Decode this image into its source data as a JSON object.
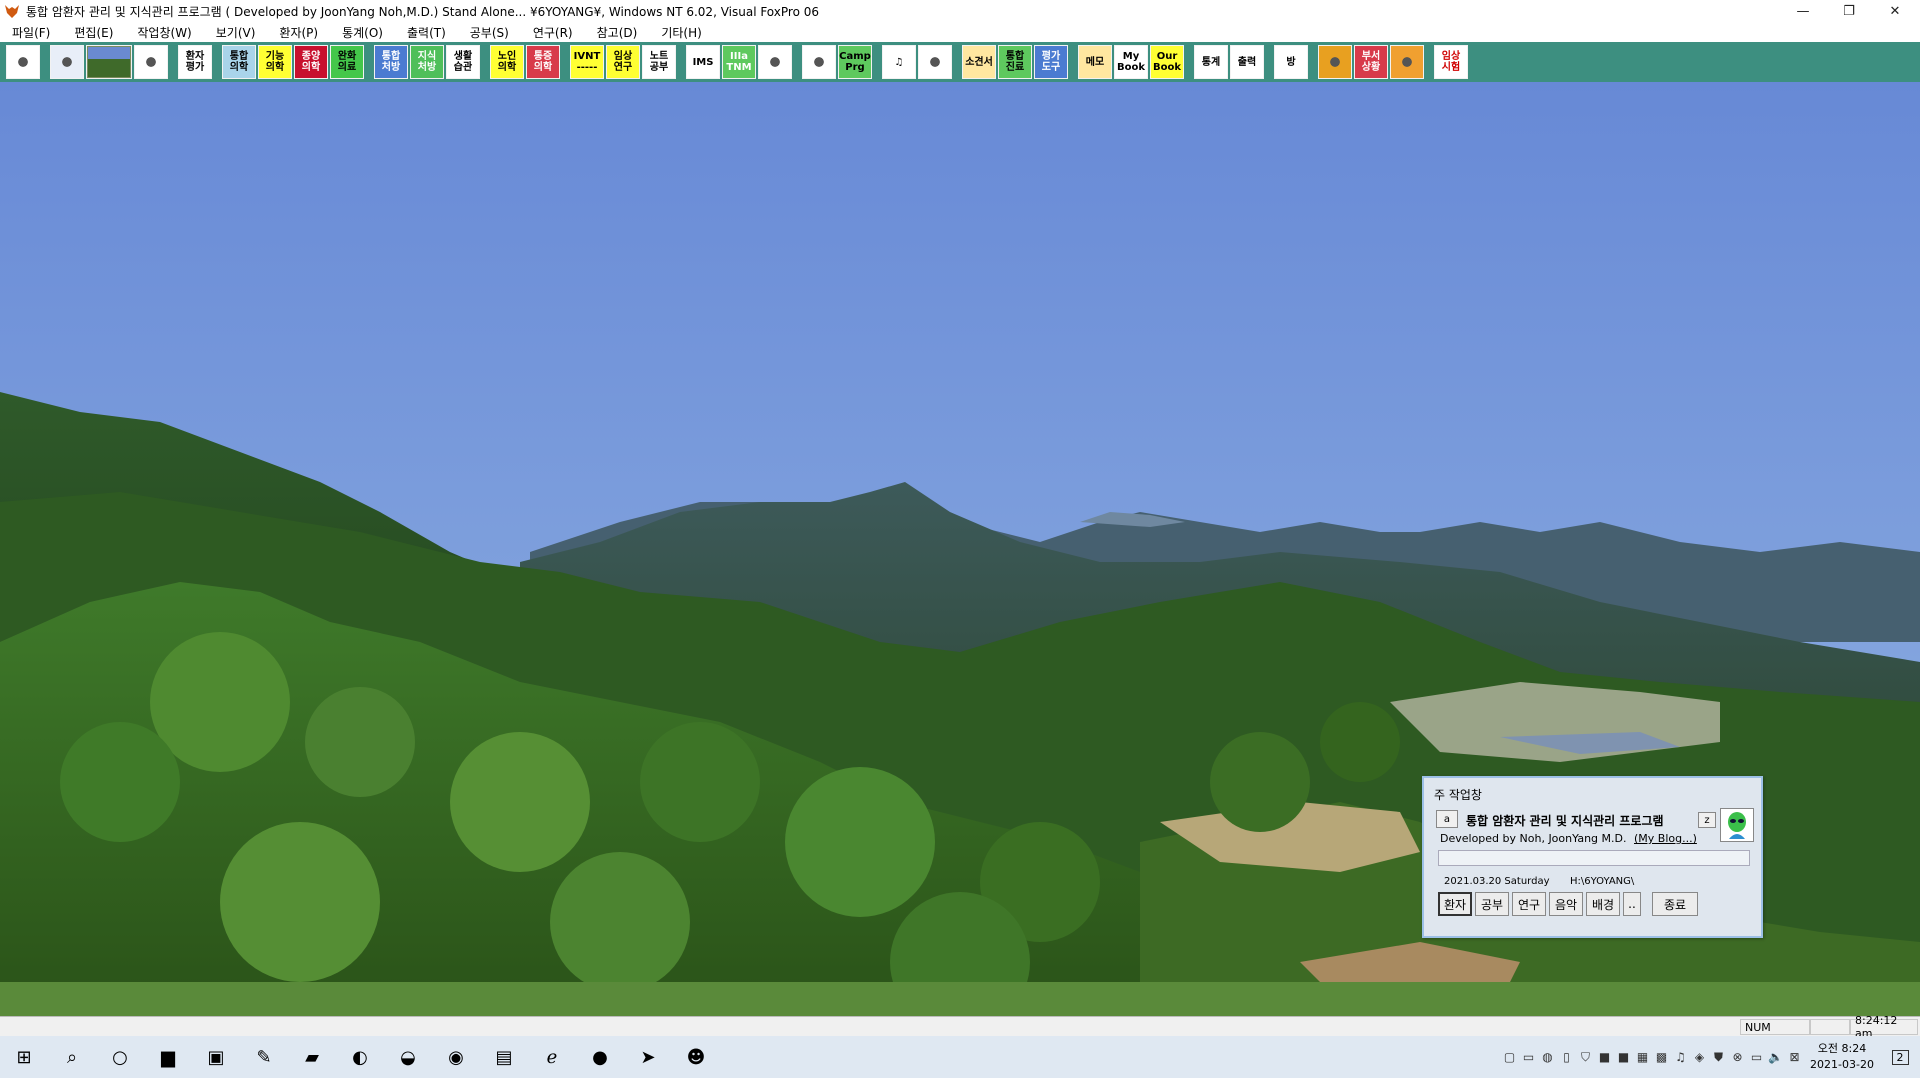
{
  "window": {
    "title": "통합 암환자 관리 및 지식관리 프로그램 ( Developed by JoonYang Noh,M.D.)   Stand Alone... ¥6YOYANG¥, Windows NT 6.02, Visual FoxPro 06",
    "min_glyph": "—",
    "max_glyph": "❐",
    "close_glyph": "✕"
  },
  "menu": [
    "파일(F)",
    "편집(E)",
    "작업창(W)",
    "보기(V)",
    "환자(P)",
    "통계(O)",
    "출력(T)",
    "공부(S)",
    "연구(R)",
    "참고(D)",
    "기타(H)"
  ],
  "toolbar": [
    {
      "label": "",
      "icon": "exit-icon",
      "bg": "#ffffff"
    },
    {
      "label": "",
      "icon": "monitor-icon",
      "bg": "#e8eef8"
    },
    {
      "label": "",
      "icon": "landscape-icon",
      "bg": "#7b8c5e",
      "wide": true
    },
    {
      "label": "",
      "icon": "face-icon",
      "bg": "#ffffff"
    },
    {
      "label": "환자\n평가",
      "icon": "",
      "bg": "#ffffff"
    },
    {
      "label": "통합\n의학",
      "icon": "",
      "bg": "#a9d4ea"
    },
    {
      "label": "기능\n의학",
      "icon": "",
      "bg": "#ffff33"
    },
    {
      "label": "종양\n의학",
      "icon": "",
      "bg": "#c8102e",
      "fg": "#ffffff"
    },
    {
      "label": "완화\n의료",
      "icon": "",
      "bg": "#44c74a"
    },
    {
      "label": "통합\n처방",
      "icon": "",
      "bg": "#4b7bd1",
      "fg": "#ffffff"
    },
    {
      "label": "지식\n처방",
      "icon": "",
      "bg": "#4fbf5a",
      "fg": "#ffffff"
    },
    {
      "label": "생활\n습관",
      "icon": "",
      "bg": "#ffffff"
    },
    {
      "label": "노인\n의학",
      "icon": "",
      "bg": "#ffff33"
    },
    {
      "label": "통증\n의학",
      "icon": "",
      "bg": "#d83a4a",
      "fg": "#ffffff"
    },
    {
      "label": "IVNT\n-----",
      "icon": "",
      "bg": "#ffff33"
    },
    {
      "label": "임상\n연구",
      "icon": "",
      "bg": "#ffff33"
    },
    {
      "label": "노트\n공부",
      "icon": "",
      "bg": "#ffffff"
    },
    {
      "label": "IMS",
      "icon": "",
      "bg": "#ffffff"
    },
    {
      "label": "IIIa\nTNM",
      "icon": "",
      "bg": "#5ec95e",
      "fg": "#ffffff"
    },
    {
      "label": "",
      "icon": "table-icon",
      "bg": "#ffffff"
    },
    {
      "label": "",
      "icon": "person-icon",
      "bg": "#ffffff"
    },
    {
      "label": "Camp\nPrg",
      "icon": "",
      "bg": "#5ec95e"
    },
    {
      "label": "♫",
      "icon": "music-icon",
      "bg": "#ffffff"
    },
    {
      "label": "",
      "icon": "meditation-icon",
      "bg": "#ffffff"
    },
    {
      "label": "소견서",
      "icon": "",
      "bg": "#ffe7a0"
    },
    {
      "label": "통합\n진료",
      "icon": "",
      "bg": "#5ec95e"
    },
    {
      "label": "평가\n도구",
      "icon": "",
      "bg": "#4b7bd1",
      "fg": "#ffffff"
    },
    {
      "label": "메모",
      "icon": "",
      "bg": "#ffe7a0"
    },
    {
      "label": "My\nBook",
      "icon": "",
      "bg": "#ffffff"
    },
    {
      "label": "Our\nBook",
      "icon": "",
      "bg": "#ffff33"
    },
    {
      "label": "통계",
      "icon": "",
      "bg": "#ffffff"
    },
    {
      "label": "출력",
      "icon": "",
      "bg": "#ffffff"
    },
    {
      "label": "방",
      "icon": "",
      "bg": "#ffffff"
    },
    {
      "label": "",
      "icon": "badge-icon",
      "bg": "#e8a020"
    },
    {
      "label": "부서\n상황",
      "icon": "",
      "bg": "#d83a4a",
      "fg": "#ffffff"
    },
    {
      "label": "",
      "icon": "food-icon",
      "bg": "#f0a030"
    },
    {
      "label": "임상\n시험",
      "icon": "",
      "bg": "#ffffff",
      "fg": "#d00000"
    }
  ],
  "main_window": {
    "title": "주 작업창",
    "a_button": "a",
    "app_name": "통합 암환자 관리 및 지식관리 프로그램",
    "z_button": "z",
    "developer": "Developed by Noh, JoonYang  M.D.",
    "blog_link": "(My Blog...)",
    "date": "2021.03.20 Saturday",
    "path": "H:\\6YOYANG\\",
    "buttons": [
      "환자",
      "공부",
      "연구",
      "음악",
      "배경",
      "..",
      "종료"
    ]
  },
  "status_bar": {
    "num": "NUM",
    "time": "8:24:12 am"
  },
  "taskbar": {
    "apps": [
      {
        "glyph": "⊞",
        "name": "windows-start-icon"
      },
      {
        "glyph": "⌕",
        "name": "search-icon"
      },
      {
        "glyph": "○",
        "name": "cortana-icon"
      },
      {
        "glyph": "▆",
        "name": "file-explorer-icon"
      },
      {
        "glyph": "▣",
        "name": "save-disk-icon"
      },
      {
        "glyph": "✎",
        "name": "paint-icon"
      },
      {
        "glyph": "▰",
        "name": "notes-icon"
      },
      {
        "glyph": "◐",
        "name": "edge-icon"
      },
      {
        "glyph": "◒",
        "name": "edge-dev-icon"
      },
      {
        "glyph": "◉",
        "name": "chrome-icon"
      },
      {
        "glyph": "▤",
        "name": "excel-icon"
      },
      {
        "glyph": "ℯ",
        "name": "internet-explorer-icon"
      },
      {
        "glyph": "●",
        "name": "blue-circle-app-icon"
      },
      {
        "glyph": "➤",
        "name": "arrow-app-icon"
      },
      {
        "glyph": "☻",
        "name": "foxpro-app-icon"
      }
    ],
    "tray": [
      {
        "glyph": "▢",
        "name": "tray-app-1-icon"
      },
      {
        "glyph": "▭",
        "name": "tray-app-2-icon"
      },
      {
        "glyph": "◍",
        "name": "tray-app-3-icon"
      },
      {
        "glyph": "▯",
        "name": "tray-usb-icon"
      },
      {
        "glyph": "⛉",
        "name": "tray-shield-icon"
      },
      {
        "glyph": "■",
        "name": "tray-app-4-icon"
      },
      {
        "glyph": "■",
        "name": "tray-app-5-icon"
      },
      {
        "glyph": "▦",
        "name": "tray-printer-icon"
      },
      {
        "glyph": "▩",
        "name": "tray-app-6-icon"
      },
      {
        "glyph": "♫",
        "name": "tray-bell-icon"
      },
      {
        "glyph": "◈",
        "name": "tray-app-7-icon"
      },
      {
        "glyph": "⛊",
        "name": "tray-defender-icon"
      },
      {
        "glyph": "⊗",
        "name": "tray-app-8-icon"
      },
      {
        "glyph": "▭",
        "name": "tray-network-icon"
      },
      {
        "glyph": "🔈",
        "name": "tray-volume-icon"
      },
      {
        "glyph": "⊠",
        "name": "tray-app-9-icon"
      }
    ],
    "clock_time": "오전 8:24",
    "clock_date": "2021-03-20",
    "notifications_count": "2"
  },
  "colors": {
    "toolbar_bg": "#3d8f80",
    "sky_top": "#6b8bd6",
    "sky_bottom": "#8fb0e0"
  }
}
